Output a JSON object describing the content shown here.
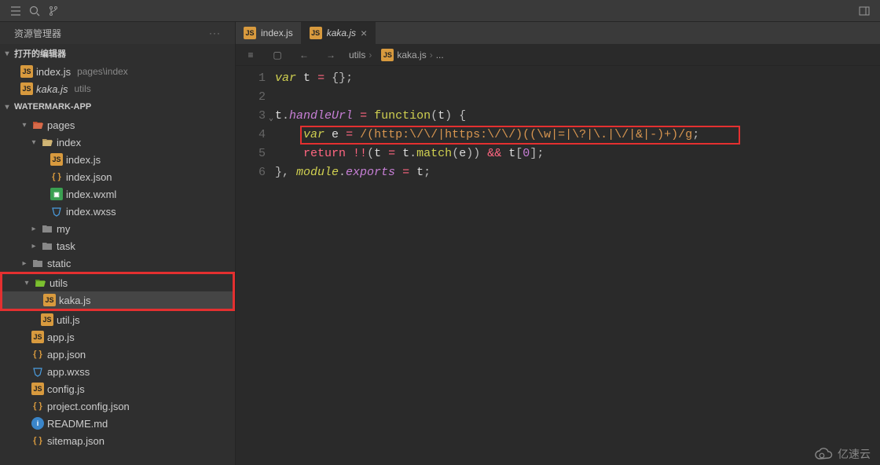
{
  "topbar": {
    "menu_icon": "menu",
    "search_icon": "search",
    "branch_icon": "branch",
    "panel_icon": "panel-right"
  },
  "sidebar": {
    "explorer_title": "资源管理器",
    "open_editors": {
      "title": "打开的编辑器",
      "items": [
        {
          "icon": "js",
          "name": "index.js",
          "path": "pages\\index"
        },
        {
          "icon": "js",
          "name": "kaka.js",
          "path": "utils",
          "italic": true
        }
      ]
    },
    "project": {
      "title": "WATERMARK-APP",
      "tree": [
        {
          "depth": 1,
          "arrow": "open",
          "icon": "folder-pages",
          "label": "pages"
        },
        {
          "depth": 2,
          "arrow": "open",
          "icon": "folder-open",
          "label": "index"
        },
        {
          "depth": 3,
          "arrow": "none",
          "icon": "js",
          "label": "index.js"
        },
        {
          "depth": 3,
          "arrow": "none",
          "icon": "json",
          "label": "index.json"
        },
        {
          "depth": 3,
          "arrow": "none",
          "icon": "wxml",
          "label": "index.wxml"
        },
        {
          "depth": 3,
          "arrow": "none",
          "icon": "wxss",
          "label": "index.wxss"
        },
        {
          "depth": 2,
          "arrow": "closed",
          "icon": "folder",
          "label": "my"
        },
        {
          "depth": 2,
          "arrow": "closed",
          "icon": "folder",
          "label": "task"
        },
        {
          "depth": 1,
          "arrow": "closed",
          "icon": "folder",
          "label": "static"
        },
        {
          "depth": 1,
          "arrow": "open",
          "icon": "folder-utils",
          "label": "utils",
          "hl": true
        },
        {
          "depth": 2,
          "arrow": "none",
          "icon": "js",
          "label": "kaka.js",
          "hl": true,
          "selected": true
        },
        {
          "depth": 2,
          "arrow": "none",
          "icon": "js",
          "label": "util.js"
        },
        {
          "depth": 1,
          "arrow": "none",
          "icon": "js",
          "label": "app.js"
        },
        {
          "depth": 1,
          "arrow": "none",
          "icon": "json",
          "label": "app.json"
        },
        {
          "depth": 1,
          "arrow": "none",
          "icon": "wxss",
          "label": "app.wxss"
        },
        {
          "depth": 1,
          "arrow": "none",
          "icon": "js",
          "label": "config.js"
        },
        {
          "depth": 1,
          "arrow": "none",
          "icon": "json",
          "label": "project.config.json"
        },
        {
          "depth": 1,
          "arrow": "none",
          "icon": "info",
          "label": "README.md"
        },
        {
          "depth": 1,
          "arrow": "none",
          "icon": "json",
          "label": "sitemap.json"
        }
      ]
    }
  },
  "tabs": [
    {
      "icon": "js",
      "label": "index.js",
      "active": false,
      "italic": false
    },
    {
      "icon": "js",
      "label": "kaka.js",
      "active": true,
      "italic": true
    }
  ],
  "breadcrumb": {
    "parts": [
      "utils",
      "kaka.js",
      "..."
    ]
  },
  "code": {
    "lines": [
      {
        "n": 1,
        "tokens": [
          [
            "k-var",
            "var"
          ],
          [
            "k-punct",
            " "
          ],
          [
            "k-ident",
            "t"
          ],
          [
            "k-punct",
            " "
          ],
          [
            "k-op",
            "="
          ],
          [
            "k-punct",
            " {};"
          ]
        ]
      },
      {
        "n": 2,
        "tokens": []
      },
      {
        "n": 3,
        "fold": true,
        "tokens": [
          [
            "k-ident",
            "t"
          ],
          [
            "k-punct",
            "."
          ],
          [
            "k-prop",
            "handleUrl"
          ],
          [
            "k-punct",
            " "
          ],
          [
            "k-op",
            "="
          ],
          [
            "k-punct",
            " "
          ],
          [
            "k-func",
            "function"
          ],
          [
            "k-punct",
            "("
          ],
          [
            "k-ident",
            "t"
          ],
          [
            "k-punct",
            ") {"
          ]
        ]
      },
      {
        "n": 4,
        "tokens": [
          [
            "k-punct",
            "    "
          ],
          [
            "k-var",
            "var"
          ],
          [
            "k-punct",
            " "
          ],
          [
            "k-ident",
            "e"
          ],
          [
            "k-punct",
            " "
          ],
          [
            "k-op",
            "="
          ],
          [
            "k-punct",
            " "
          ],
          [
            "k-regex",
            "/(http:\\/\\/|https:\\/\\/)((\\w|=|\\?|\\.|\\/|&|-)+)/g"
          ],
          [
            "k-punct",
            ";"
          ]
        ]
      },
      {
        "n": 5,
        "tokens": [
          [
            "k-punct",
            "    "
          ],
          [
            "k-kw",
            "return"
          ],
          [
            "k-punct",
            " "
          ],
          [
            "k-op",
            "!!"
          ],
          [
            "k-punct",
            "("
          ],
          [
            "k-ident",
            "t"
          ],
          [
            "k-punct",
            " "
          ],
          [
            "k-op",
            "="
          ],
          [
            "k-punct",
            " "
          ],
          [
            "k-ident",
            "t"
          ],
          [
            "k-punct",
            "."
          ],
          [
            "k-func",
            "match"
          ],
          [
            "k-punct",
            "("
          ],
          [
            "k-ident",
            "e"
          ],
          [
            "k-punct",
            ")) "
          ],
          [
            "k-op",
            "&&"
          ],
          [
            "k-punct",
            " "
          ],
          [
            "k-ident",
            "t"
          ],
          [
            "k-punct",
            "["
          ],
          [
            "k-num",
            "0"
          ],
          [
            "k-punct",
            "];"
          ]
        ]
      },
      {
        "n": 6,
        "tokens": [
          [
            "k-punct",
            "}, "
          ],
          [
            "k-mod",
            "module"
          ],
          [
            "k-punct",
            "."
          ],
          [
            "k-prop",
            "exports"
          ],
          [
            "k-punct",
            " "
          ],
          [
            "k-op",
            "="
          ],
          [
            "k-punct",
            " "
          ],
          [
            "k-ident",
            "t"
          ],
          [
            "k-punct",
            ";"
          ]
        ]
      }
    ]
  },
  "watermark": "亿速云"
}
